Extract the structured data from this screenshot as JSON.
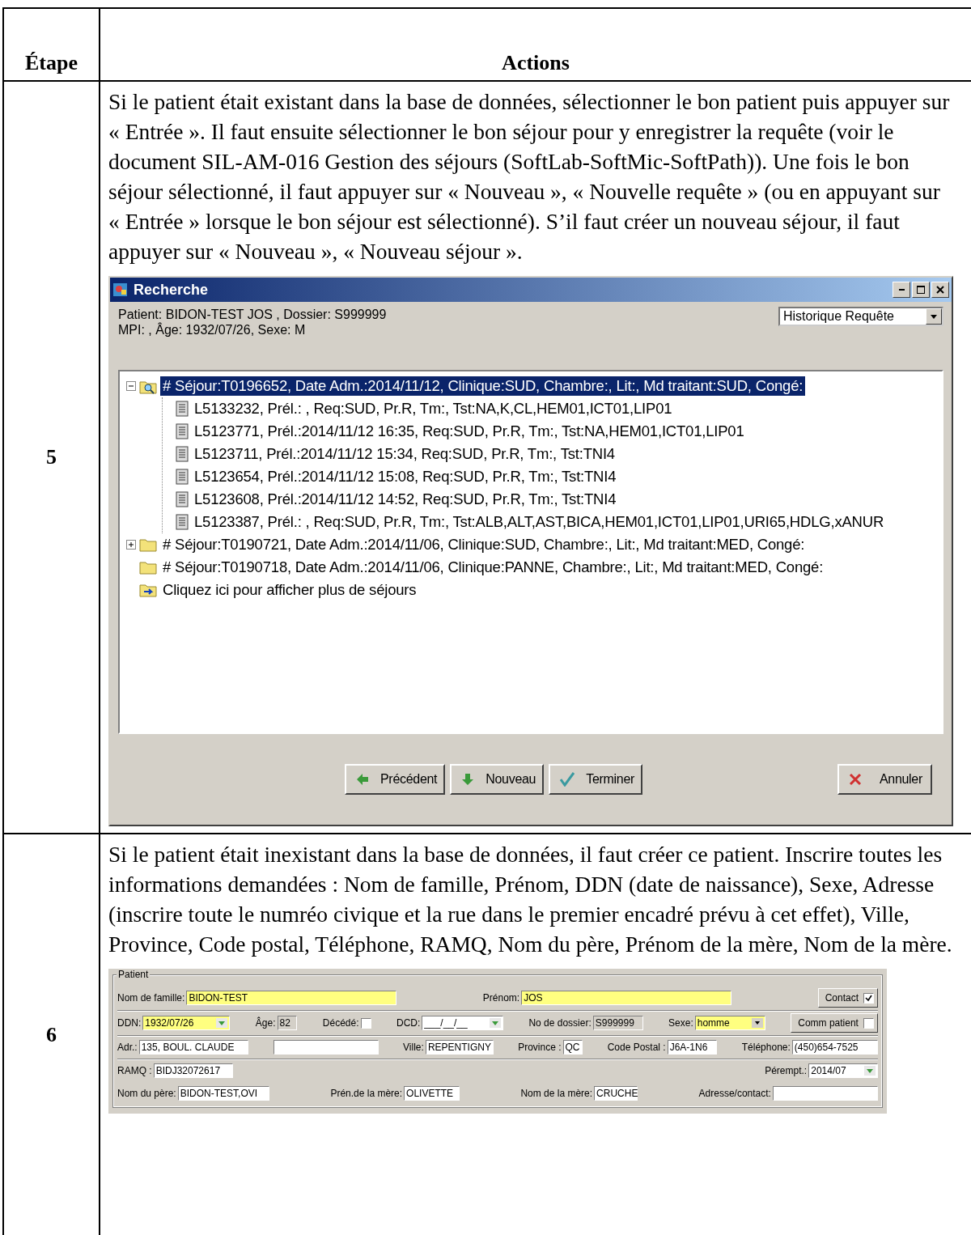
{
  "table": {
    "columns": [
      "Étape",
      "Actions"
    ],
    "rows": [
      {
        "step": "5",
        "text": "Si le patient était existant dans la base de données, sélectionner le bon patient puis appuyer sur « Entrée ». Il faut ensuite sélectionner le bon séjour pour y enregistrer la requête (voir le document SIL-AM-016 Gestion des séjours (SoftLab-SoftMic-SoftPath)). Une fois le bon séjour sélectionné, il faut appuyer sur « Nouveau », « Nouvelle requête » (ou en appuyant sur « Entrée » lorsque le bon séjour est sélectionné). S’il faut créer un nouveau séjour, il faut appuyer sur « Nouveau », « Nouveau séjour ».",
        "screen": {
          "kind": "search_window",
          "title": "Recherche",
          "info_lines": [
            "Patient: BIDON-TEST JOS ,   Dossier: S999999",
            "MPI: ,   Âge: 1932/07/26,   Sexe: M"
          ],
          "dropdown": {
            "value": "Historique Requête"
          },
          "tree": [
            {
              "text": "# Séjour:T0196652, Date Adm.:2014/11/12, Clinique:SUD, Chambre:, Lit:, Md traitant:SUD, Congé:",
              "kind": "search_folder",
              "selected": true,
              "expanded": true,
              "children": [
                {
                  "text": "L5133232, Prél.: , Req:SUD, Pr.R, Tm:, Tst:NA,K,CL,HEM01,ICT01,LIP01",
                  "kind": "document",
                  "selected": false
                },
                {
                  "text": "L5123771, Prél.:2014/11/12 16:35, Req:SUD, Pr.R, Tm:, Tst:NA,HEM01,ICT01,LIP01",
                  "kind": "document",
                  "selected": false
                },
                {
                  "text": "L5123711, Prél.:2014/11/12 15:34, Req:SUD, Pr.R, Tm:, Tst:TNI4",
                  "kind": "document",
                  "selected": false
                },
                {
                  "text": "L5123654, Prél.:2014/11/12 15:08, Req:SUD, Pr.R, Tm:, Tst:TNI4",
                  "kind": "document",
                  "selected": false
                },
                {
                  "text": "L5123608, Prél.:2014/11/12 14:52, Req:SUD, Pr.R, Tm:, Tst:TNI4",
                  "kind": "document",
                  "selected": false
                },
                {
                  "text": "L5123387, Prél.: , Req:SUD, Pr.R, Tm:, Tst:ALB,ALT,AST,BICA,HEM01,ICT01,LIP01,URI65,HDLG,xANUR",
                  "kind": "document",
                  "selected": false
                }
              ]
            },
            {
              "text": "# Séjour:T0190721, Date Adm.:2014/11/06, Clinique:SUD, Chambre:, Lit:, Md traitant:MED, Congé:",
              "kind": "folder",
              "selected": false,
              "expanded": false
            },
            {
              "text": "# Séjour:T0190718, Date Adm.:2014/11/06, Clinique:PANNE, Chambre:, Lit:, Md traitant:MED, Congé:",
              "kind": "folder",
              "selected": false
            },
            {
              "text": "Cliquez ici pour afficher plus de séjours",
              "kind": "more",
              "selected": false
            }
          ],
          "buttons": [
            {
              "label": "Précédent",
              "kind": "back"
            },
            {
              "label": "Nouveau",
              "kind": "forward"
            },
            {
              "label": "Terminer",
              "kind": "finish"
            },
            {
              "label": "Annuler",
              "kind": "cancel"
            }
          ]
        }
      },
      {
        "step": "6",
        "text": "Si le patient était inexistant dans la base de données, il faut créer ce patient. Inscrire toutes les informations demandées : Nom de famille, Prénom, DDN (date de naissance), Sexe, Adresse (inscrire toute le numréo civique et la rue dans le premier encadré prévu à cet effet), Ville, Province, Code postal, Téléphone, RAMQ, Nom du père, Prénom de la mère, Nom de la mère.",
        "screen": {
          "kind": "patient_form",
          "group": "Patient",
          "sections": [
            [
              [
                {
                  "label": "Nom de famille:",
                  "value": "BIDON-TEST",
                  "kind": "text",
                  "highlighted": true,
                  "disabled": false
                },
                {
                  "label": "Prénom:",
                  "value": "JOS",
                  "kind": "text",
                  "highlighted": true,
                  "disabled": false
                },
                {
                  "label": "Contact",
                  "kind": "check",
                  "checked": true
                }
              ]
            ],
            [
              [
                {
                  "label": "DDN:",
                  "value": "1932/07/26",
                  "kind": "date",
                  "highlighted": true,
                  "disabled": false
                },
                {
                  "label": "Âge:",
                  "value": "82",
                  "kind": "text",
                  "highlighted": false,
                  "disabled": true
                },
                {
                  "label": "Décédé:",
                  "kind": "inline_check",
                  "checked": false
                },
                {
                  "label": "DCD:",
                  "value": "___/__/__",
                  "kind": "date",
                  "highlighted": false,
                  "disabled": false
                },
                {
                  "label": "No de dossier:",
                  "value": "S999999",
                  "kind": "text",
                  "highlighted": false,
                  "disabled": true
                },
                {
                  "label": "Sexe:",
                  "value": "homme",
                  "kind": "select",
                  "highlighted": true,
                  "disabled": false
                },
                {
                  "label": "Comm patient",
                  "kind": "check",
                  "checked": false
                }
              ]
            ],
            [
              [
                {
                  "label": "Adr.:",
                  "value": "135, BOUL. CLAUDE",
                  "kind": "text",
                  "highlighted": false,
                  "disabled": false
                },
                {
                  "kind": "text",
                  "highlighted": false,
                  "disabled": false
                },
                {
                  "label": "Ville:",
                  "value": "REPENTIGNY",
                  "kind": "text",
                  "highlighted": false,
                  "disabled": false
                },
                {
                  "label": "Province :",
                  "value": "QC",
                  "kind": "text",
                  "highlighted": false,
                  "disabled": false
                },
                {
                  "label": "Code Postal :",
                  "value": "J6A-1N6",
                  "kind": "text",
                  "highlighted": false,
                  "disabled": false
                },
                {
                  "label": "Téléphone:",
                  "value": "(450)654-7525",
                  "kind": "text",
                  "highlighted": false,
                  "disabled": false
                }
              ]
            ],
            [
              [
                {
                  "label": "RAMQ :",
                  "value": "BIDJ32072617",
                  "kind": "text",
                  "highlighted": false,
                  "disabled": false
                },
                {
                  "label": "Pérempt.:",
                  "value": "2014/07",
                  "kind": "date",
                  "highlighted": false,
                  "disabled": false
                }
              ],
              [
                {
                  "label": "Nom du père:",
                  "value": "BIDON-TEST,OVI",
                  "kind": "text",
                  "highlighted": false,
                  "disabled": false
                },
                {
                  "label": "Prén.de la mère:",
                  "value": "OLIVETTE",
                  "kind": "text",
                  "highlighted": false,
                  "disabled": false
                },
                {
                  "label": "Nom de la mère:",
                  "value": "CRUCHE",
                  "kind": "text",
                  "highlighted": false,
                  "disabled": false
                },
                {
                  "label": "Adresse/contact:",
                  "kind": "text",
                  "highlighted": false,
                  "disabled": false
                }
              ]
            ]
          ]
        }
      }
    ]
  }
}
